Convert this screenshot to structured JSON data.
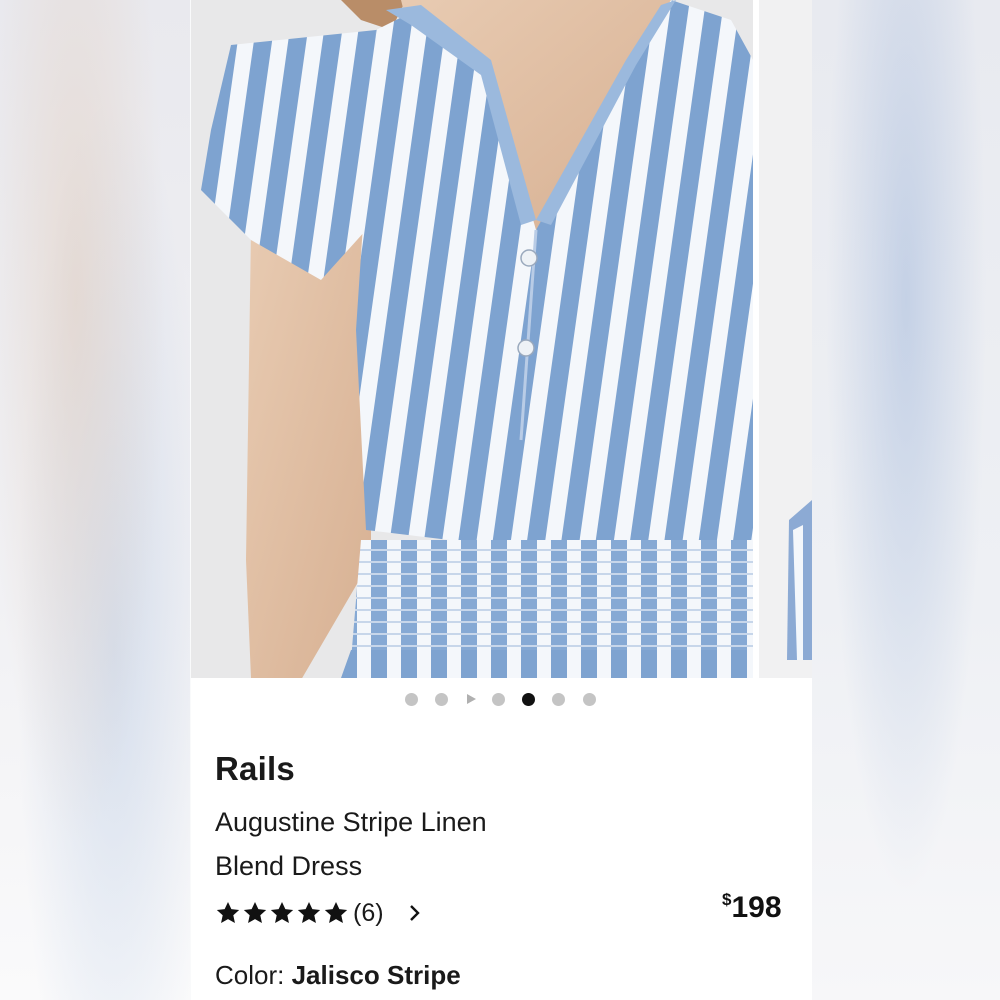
{
  "product": {
    "brand": "Rails",
    "name_line1": "Augustine Stripe Linen",
    "name_line2": "Blend Dress",
    "rating_count": "(6)",
    "rating_value": 5,
    "price_currency": "$",
    "price_amount": "198",
    "color_label": "Color:",
    "color_value": "Jalisco Stripe"
  },
  "carousel": {
    "total_items": 7,
    "active_index": 4,
    "video_index": 2
  },
  "icons": {
    "star": "star-icon",
    "chevron": "chevron-right-icon",
    "play": "play-icon"
  },
  "colors": {
    "stripe_blue": "#7ea3d0",
    "stripe_white": "#f4f7fb",
    "active_dot": "#111111",
    "inactive_dot": "#c4c4c4",
    "star_fill": "#111111"
  }
}
